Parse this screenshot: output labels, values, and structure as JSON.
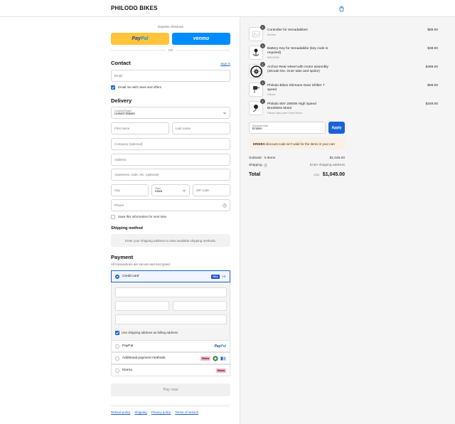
{
  "header": {
    "brand": "PHILODO BIKES",
    "cart_icon": "shopping-bag-icon"
  },
  "express": {
    "label": "Express checkout",
    "paypal_pay": "Pay",
    "paypal_pal": "Pal",
    "venmo": "venmo",
    "or": "OR"
  },
  "contact": {
    "title": "Contact",
    "sign_in": "Sign in",
    "email_placeholder": "Email",
    "email_news_label": "Email me with news and offers",
    "email_news_checked": true
  },
  "delivery": {
    "title": "Delivery",
    "country_label": "Country/Region",
    "country_value": "United States",
    "first_name": "First name",
    "last_name": "Last name",
    "company": "Company (optional)",
    "address": "Address",
    "apartment": "Apartment, suite, etc. (optional)",
    "city": "City",
    "state_label": "State",
    "state_value": "Iowa",
    "zip": "ZIP code",
    "phone": "Phone",
    "save_info_label": "Save this information for next time",
    "save_info_checked": false
  },
  "shipping_method": {
    "title": "Shipping method",
    "message": "Enter your shipping address to view available shipping methods."
  },
  "payment": {
    "title": "Payment",
    "subtitle": "All transactions are secure and encrypted.",
    "credit_card_label": "Credit card",
    "card_badge": "VISA",
    "more_cards": "+4",
    "billing_same_label": "Use shipping address as billing address",
    "billing_same_checked": true,
    "paypal_label": "PayPal",
    "paypal_logo_a": "Pay",
    "paypal_logo_b": "Pal",
    "additional_label": "Additional payment methods",
    "klarna_badge": "Klarna",
    "klarna_label": "Klarna",
    "pay_now": "Pay now"
  },
  "footer": {
    "links": [
      "Refund policy",
      "Shipping",
      "Privacy policy",
      "Terms of service"
    ]
  },
  "cart": {
    "items": [
      {
        "qty": "1",
        "name": "Controller for Senadabikes",
        "variant": "Archon",
        "price": "$89.00"
      },
      {
        "qty": "1",
        "name": "Battery Key for Senadabike (key code is required)",
        "variant": "ARCHON",
        "price": "$39.00"
      },
      {
        "qty": "1",
        "name": "Archon Rear wheel with motor assembly (inlcude tire, inner tube and spoke)",
        "variant": "",
        "price": "$489.00"
      },
      {
        "qty": "1",
        "name": "Philodo Bikes Shimano Gear Shifter 7 speed",
        "variant": "Falcon",
        "price": "$69.00"
      },
      {
        "qty": "1",
        "name": "Philodo 60V 2000W High Speed Brushless Motor",
        "variant": "Falcon step-over Front Motor",
        "price": "$349.00"
      }
    ],
    "discount_label": "Discount code",
    "discount_value": "Erides",
    "apply": "Apply",
    "error_code": "ERIDES",
    "error_text": "discount code isn't valid for the items in your cart",
    "subtotal_label": "Subtotal · 5 items",
    "subtotal_value": "$1,045.00",
    "shipping_label": "Shipping",
    "shipping_value": "Enter shipping address",
    "total_label": "Total",
    "total_currency": "USD",
    "total_value": "$1,045.00"
  },
  "colors": {
    "accent": "#1a62d6",
    "paypal_yellow": "#ffc439",
    "venmo_blue": "#008cff",
    "error_bg": "#fcefe3"
  }
}
